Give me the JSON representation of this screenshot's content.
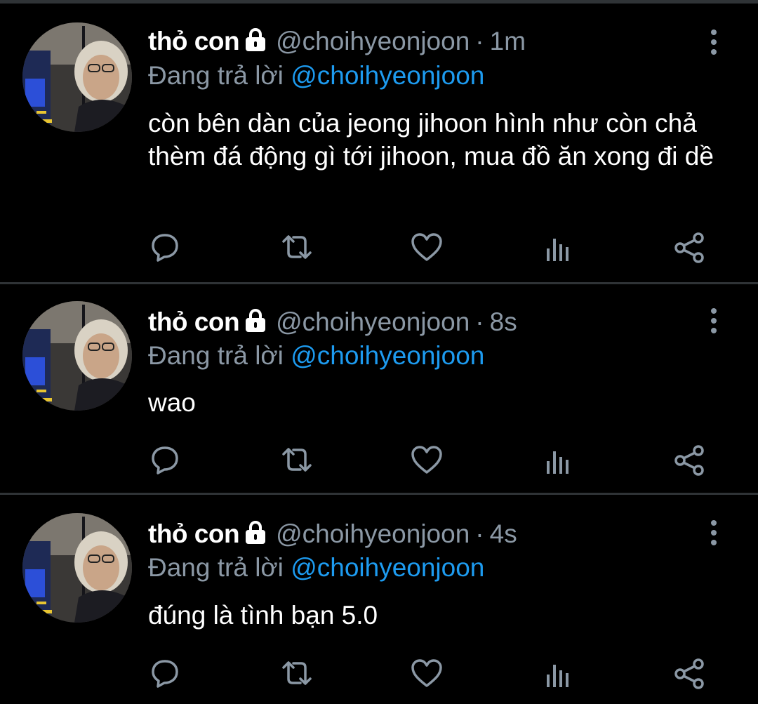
{
  "colors": {
    "background": "#000000",
    "separator": "#2f3336",
    "text_primary": "#ffffff",
    "text_secondary": "#8b98a5",
    "accent": "#1d9bf0"
  },
  "icons": {
    "lock": "lock-icon",
    "more": "more-vertical-icon",
    "reply": "reply-icon",
    "retweet": "retweet-icon",
    "like": "heart-icon",
    "analytics": "analytics-icon",
    "share": "share-icon"
  },
  "tweets": [
    {
      "display_name": "thỏ con",
      "handle": "@choihyeonjoon",
      "separator": "·",
      "time": "1m",
      "reply_prefix": "Đang trả lời",
      "reply_to": "@choihyeonjoon",
      "text": "còn bên dàn của jeong jihoon hình như còn chả thèm đá động gì tới jihoon, mua đồ ăn xong đi dề"
    },
    {
      "display_name": "thỏ con",
      "handle": "@choihyeonjoon",
      "separator": "·",
      "time": "8s",
      "reply_prefix": "Đang trả lời",
      "reply_to": "@choihyeonjoon",
      "text": "wao"
    },
    {
      "display_name": "thỏ con",
      "handle": "@choihyeonjoon",
      "separator": "·",
      "time": "4s",
      "reply_prefix": "Đang trả lời",
      "reply_to": "@choihyeonjoon",
      "text": "đúng là tình bạn 5.0"
    }
  ]
}
